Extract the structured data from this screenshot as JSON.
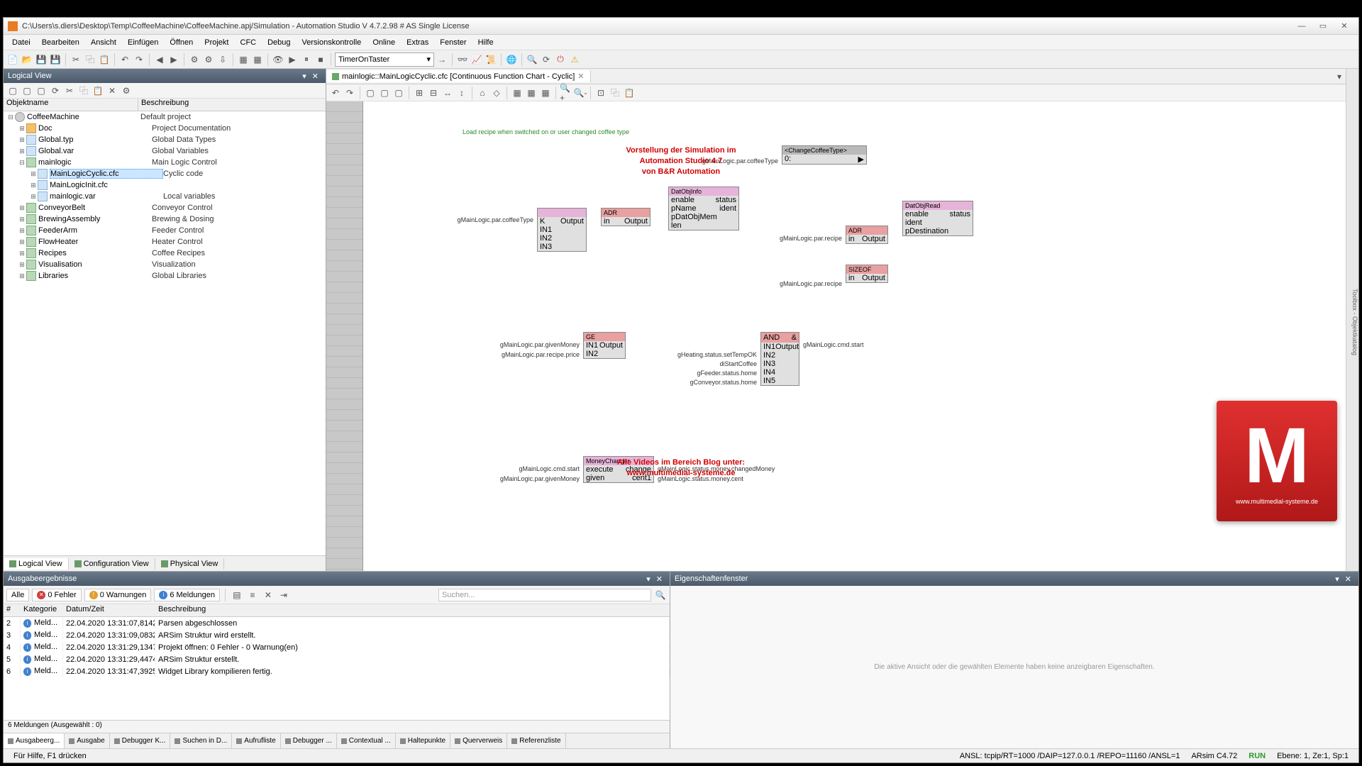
{
  "window": {
    "title": "C:\\Users\\s.diers\\Desktop\\Temp\\CoffeeMachine\\CoffeeMachine.apj/Simulation - Automation Studio V 4.7.2.98 # AS Single License"
  },
  "menu": [
    "Datei",
    "Bearbeiten",
    "Ansicht",
    "Einfügen",
    "Öffnen",
    "Projekt",
    "CFC",
    "Debug",
    "Versionskontrolle",
    "Online",
    "Extras",
    "Fenster",
    "Hilfe"
  ],
  "toolbar_combo": "TimerOnTaster",
  "left_pane": {
    "title": "Logical View",
    "columns": [
      "Objektname",
      "Beschreibung"
    ],
    "tree": [
      {
        "lvl": 0,
        "tw": "-",
        "ico": "cog",
        "name": "CoffeeMachine",
        "desc": "Default project"
      },
      {
        "lvl": 1,
        "tw": "+",
        "ico": "folder",
        "name": "Doc",
        "desc": "Project Documentation"
      },
      {
        "lvl": 1,
        "tw": "+",
        "ico": "file",
        "name": "Global.typ",
        "desc": "Global Data Types"
      },
      {
        "lvl": 1,
        "tw": "+",
        "ico": "file",
        "name": "Global.var",
        "desc": "Global Variables"
      },
      {
        "lvl": 1,
        "tw": "-",
        "ico": "pkg",
        "name": "mainlogic",
        "desc": "Main Logic Control"
      },
      {
        "lvl": 2,
        "tw": "+",
        "ico": "file",
        "name": "MainLogicCyclic.cfc",
        "desc": "Cyclic code",
        "sel": true
      },
      {
        "lvl": 2,
        "tw": "+",
        "ico": "file",
        "name": "MainLogicInit.cfc",
        "desc": ""
      },
      {
        "lvl": 2,
        "tw": "+",
        "ico": "file",
        "name": "mainlogic.var",
        "desc": "Local variables"
      },
      {
        "lvl": 1,
        "tw": "+",
        "ico": "pkg",
        "name": "ConveyorBelt",
        "desc": "Conveyor Control"
      },
      {
        "lvl": 1,
        "tw": "+",
        "ico": "pkg",
        "name": "BrewingAssembly",
        "desc": "Brewing & Dosing"
      },
      {
        "lvl": 1,
        "tw": "+",
        "ico": "pkg",
        "name": "FeederArm",
        "desc": "Feeder Control"
      },
      {
        "lvl": 1,
        "tw": "+",
        "ico": "pkg",
        "name": "FlowHeater",
        "desc": "Heater Control"
      },
      {
        "lvl": 1,
        "tw": "+",
        "ico": "pkg",
        "name": "Recipes",
        "desc": "Coffee Recipes"
      },
      {
        "lvl": 1,
        "tw": "+",
        "ico": "pkg",
        "name": "Visualisation",
        "desc": "Visualization"
      },
      {
        "lvl": 1,
        "tw": "+",
        "ico": "pkg",
        "name": "Libraries",
        "desc": "Global Libraries"
      }
    ],
    "view_tabs": [
      "Logical View",
      "Configuration View",
      "Physical View"
    ]
  },
  "editor": {
    "tab": "mainlogic::MainLogicCyclic.cfc [Continuous Function Chart - Cyclic]",
    "comment1": "Load recipe when switched on or user changed coffee type",
    "blocks": {
      "changeType": {
        "name": "<ChangeCoffeeType>",
        "in": "0:"
      },
      "datObjInfo": {
        "name": "DatObjInfo",
        "ports": [
          "enable",
          "status",
          "pName",
          "ident",
          "pDatObjMem",
          "len"
        ]
      },
      "adr": {
        "name": "ADR",
        "ports": [
          "in",
          "Output"
        ]
      },
      "datObjRead": {
        "name": "DatObjRead",
        "ports": [
          "enable",
          "status",
          "ident",
          "pDestination"
        ]
      },
      "sizeof": {
        "name": "SIZEOF",
        "ports": [
          "in",
          "Output"
        ]
      },
      "ge": {
        "name": "GE",
        "ports": [
          "IN1",
          "Output",
          "IN2"
        ]
      },
      "and": {
        "name": "AND",
        "sym": "&",
        "ports": [
          "IN1",
          "Output",
          "IN2",
          "IN3",
          "IN4",
          "IN5"
        ]
      },
      "moneyChanger": {
        "name": "MoneyChanger",
        "ports": [
          "execute",
          "change",
          "given",
          "cent1"
        ]
      },
      "mux": {
        "ports": [
          "K",
          "Output",
          "IN1",
          "IN2",
          "IN3"
        ]
      }
    },
    "labels": {
      "coffeeType1": "gMainLogic.par.coffeeType",
      "coffeeType2": "gMainLogic.par.coffeeType",
      "recipe": "gMainLogic.par.recipe",
      "givenMoney": "gMainLogic.par.givenMoney",
      "recipePrice": "gMainLogic.par.recipe.price",
      "cmdStart": "gMainLogic.cmd.start",
      "setTempOK": "gHeating.status.setTempOK",
      "diStartCoffee": "diStartCoffee",
      "feederHome": "gFeeder.status.home",
      "conveyorHome": "gConveyor.status.home",
      "cmdStart2": "gMainLogic.cmd.start",
      "givenMoney2": "gMainLogic.par.givenMoney",
      "changedMoney": "gMainLogic.status.money.changedMoney",
      "moneyCent": "gMainLogic.status.money.cent"
    }
  },
  "right_rail": "Toolbox - Objektkatalog",
  "output": {
    "title": "Ausgabeergebnisse",
    "filters": {
      "all": "Alle",
      "err": "0 Fehler",
      "warn": "0 Warnungen",
      "info": "6 Meldungen"
    },
    "search_placeholder": "Suchen...",
    "columns": [
      "#",
      "Kategorie",
      "Datum/Zeit",
      "Beschreibung"
    ],
    "rows": [
      {
        "n": "2",
        "cat": "Meld...",
        "dt": "22.04.2020 13:31:07,8142",
        "msg": "Parsen abgeschlossen"
      },
      {
        "n": "3",
        "cat": "Meld...",
        "dt": "22.04.2020 13:31:09,0832",
        "msg": "ARSim Struktur wird erstellt."
      },
      {
        "n": "4",
        "cat": "Meld...",
        "dt": "22.04.2020 13:31:29,1347",
        "msg": "Projekt öffnen: 0 Fehler - 0 Warnung(en)"
      },
      {
        "n": "5",
        "cat": "Meld...",
        "dt": "22.04.2020 13:31:29,4474",
        "msg": "ARSim Struktur erstellt."
      },
      {
        "n": "6",
        "cat": "Meld...",
        "dt": "22.04.2020 13:31:47,3925",
        "msg": "Widget Library kompilieren fertig."
      }
    ],
    "status": "6 Meldungen (Ausgewählt : 0)",
    "tabs": [
      "Ausgabeerg...",
      "Ausgabe",
      "Debugger K...",
      "Suchen in D...",
      "Aufrufliste",
      "Debugger ...",
      "Contextual ...",
      "Haltepunkte",
      "Querverweis",
      "Referenzliste"
    ]
  },
  "properties": {
    "title": "Eigenschaftenfenster",
    "empty": "Die aktive Ansicht oder die gewählten Elemente haben keine anzeigbaren Eigenschaften."
  },
  "statusbar": {
    "help": "Für Hilfe, F1 drücken",
    "conn": "ANSL: tcpip/RT=1000 /DAIP=127.0.0.1 /REPO=11160 /ANSL=1",
    "sim": "ARsim  C4.72",
    "run": "RUN",
    "pos": "Ebene: 1, Ze:1, Sp:1"
  },
  "overlay": {
    "line1": "Vorstellung der Simulation im",
    "line2": "Automation Studio 4.7",
    "line3": "von B&R Automation",
    "line4": "Alle Videos im Bereich Blog unter:",
    "line5": "www.multimedial-systeme.de",
    "logo_url": "www.multimedial-systeme.de"
  }
}
